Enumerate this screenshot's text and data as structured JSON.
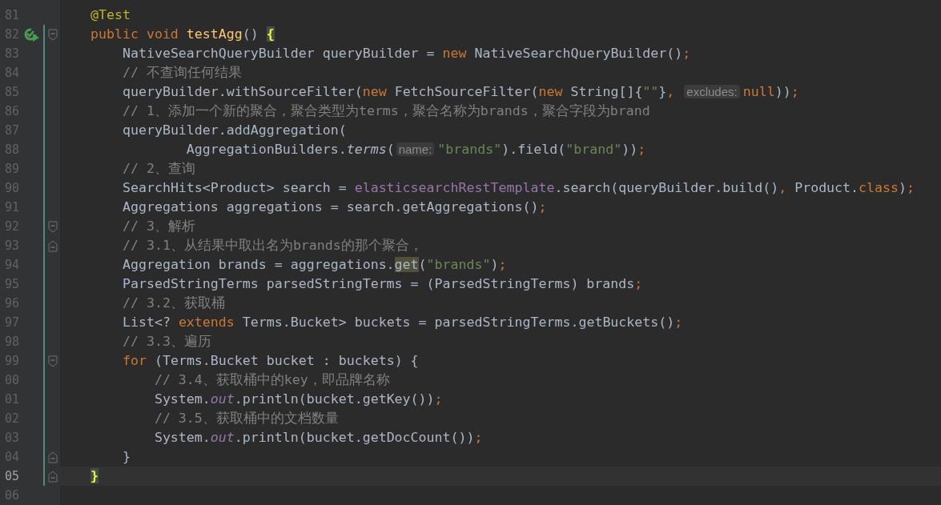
{
  "editor": {
    "lines": [
      {
        "number": "81",
        "modified": false,
        "current": false,
        "run_button": false,
        "fold_start": false,
        "fold_end": false,
        "tokens": [
          {
            "text": "    @Test",
            "kind": "annotation"
          }
        ]
      },
      {
        "number": "82",
        "modified": true,
        "current": false,
        "run_button": true,
        "fold_start": true,
        "fold_end": false,
        "tokens": [
          {
            "text": "    public void ",
            "kind": "keyword"
          },
          {
            "text": "testAgg",
            "kind": "method_decl"
          },
          {
            "text": "() ",
            "kind": "plain"
          },
          {
            "text": "{",
            "kind": "brace_match"
          }
        ]
      },
      {
        "number": "83",
        "modified": true,
        "current": false,
        "run_button": false,
        "fold_start": false,
        "fold_end": false,
        "tokens": [
          {
            "text": "        NativeSearchQueryBuilder queryBuilder = ",
            "kind": "plain"
          },
          {
            "text": "new",
            "kind": "keyword"
          },
          {
            "text": " NativeSearchQueryBuilder()",
            "kind": "plain"
          },
          {
            "text": ";",
            "kind": "punct"
          }
        ]
      },
      {
        "number": "84",
        "modified": true,
        "current": false,
        "run_button": false,
        "fold_start": false,
        "fold_end": false,
        "tokens": [
          {
            "text": "        // 不查询任何结果",
            "kind": "comment"
          }
        ]
      },
      {
        "number": "85",
        "modified": true,
        "current": false,
        "run_button": false,
        "fold_start": false,
        "fold_end": false,
        "tokens": [
          {
            "text": "        queryBuilder.withSourceFilter(",
            "kind": "plain"
          },
          {
            "text": "new",
            "kind": "keyword"
          },
          {
            "text": " FetchSourceFilter(",
            "kind": "plain"
          },
          {
            "text": "new",
            "kind": "keyword"
          },
          {
            "text": " String[]{",
            "kind": "plain"
          },
          {
            "text": "\"\"",
            "kind": "string"
          },
          {
            "text": "}",
            "kind": "plain"
          },
          {
            "text": ", ",
            "kind": "punct"
          },
          {
            "text": "excludes:",
            "kind": "hint"
          },
          {
            "text": "null",
            "kind": "keyword"
          },
          {
            "text": "))",
            "kind": "plain"
          },
          {
            "text": ";",
            "kind": "punct"
          }
        ]
      },
      {
        "number": "86",
        "modified": true,
        "current": false,
        "run_button": false,
        "fold_start": false,
        "fold_end": false,
        "tokens": [
          {
            "text": "        // 1、添加一个新的聚合，聚合类型为terms，聚合名称为brands，聚合字段为brand",
            "kind": "comment"
          }
        ]
      },
      {
        "number": "87",
        "modified": true,
        "current": false,
        "run_button": false,
        "fold_start": false,
        "fold_end": false,
        "tokens": [
          {
            "text": "        queryBuilder.addAggregation(",
            "kind": "plain"
          }
        ]
      },
      {
        "number": "88",
        "modified": true,
        "current": false,
        "run_button": false,
        "fold_start": false,
        "fold_end": false,
        "tokens": [
          {
            "text": "                AggregationBuilders.",
            "kind": "plain"
          },
          {
            "text": "terms",
            "kind": "static_call"
          },
          {
            "text": "(",
            "kind": "plain"
          },
          {
            "text": "name:",
            "kind": "hint"
          },
          {
            "text": "\"brands\"",
            "kind": "string"
          },
          {
            "text": ").field(",
            "kind": "plain"
          },
          {
            "text": "\"brand\"",
            "kind": "string"
          },
          {
            "text": "))",
            "kind": "plain"
          },
          {
            "text": ";",
            "kind": "punct"
          }
        ]
      },
      {
        "number": "89",
        "modified": true,
        "current": false,
        "run_button": false,
        "fold_start": false,
        "fold_end": false,
        "tokens": [
          {
            "text": "        // 2、查询",
            "kind": "comment"
          }
        ]
      },
      {
        "number": "90",
        "modified": true,
        "current": false,
        "run_button": false,
        "fold_start": false,
        "fold_end": false,
        "tokens": [
          {
            "text": "        SearchHits<Product> search = ",
            "kind": "plain"
          },
          {
            "text": "elasticsearchRestTemplate",
            "kind": "field"
          },
          {
            "text": ".search(queryBuilder.build()",
            "kind": "plain"
          },
          {
            "text": ",",
            "kind": "punct"
          },
          {
            "text": " Product.",
            "kind": "plain"
          },
          {
            "text": "class",
            "kind": "keyword"
          },
          {
            "text": ")",
            "kind": "plain"
          },
          {
            "text": ";",
            "kind": "punct"
          }
        ]
      },
      {
        "number": "91",
        "modified": true,
        "current": false,
        "run_button": false,
        "fold_start": false,
        "fold_end": false,
        "tokens": [
          {
            "text": "        Aggregations aggregations = search.getAggregations()",
            "kind": "plain"
          },
          {
            "text": ";",
            "kind": "punct"
          }
        ]
      },
      {
        "number": "92",
        "modified": true,
        "current": false,
        "run_button": false,
        "fold_start": true,
        "fold_end": false,
        "tokens": [
          {
            "text": "        // 3、解析",
            "kind": "comment"
          }
        ]
      },
      {
        "number": "93",
        "modified": true,
        "current": false,
        "run_button": false,
        "fold_start": false,
        "fold_end": true,
        "tokens": [
          {
            "text": "        // 3.1、从结果中取出名为brands的那个聚合，",
            "kind": "comment"
          }
        ]
      },
      {
        "number": "94",
        "modified": true,
        "current": false,
        "run_button": false,
        "fold_start": false,
        "fold_end": false,
        "tokens": [
          {
            "text": "        Aggregation brands = aggregations.",
            "kind": "plain"
          },
          {
            "text": "get",
            "kind": "usage"
          },
          {
            "text": "(",
            "kind": "plain"
          },
          {
            "text": "\"brands\"",
            "kind": "string"
          },
          {
            "text": ")",
            "kind": "plain"
          },
          {
            "text": ";",
            "kind": "punct"
          }
        ]
      },
      {
        "number": "95",
        "modified": true,
        "current": false,
        "run_button": false,
        "fold_start": false,
        "fold_end": false,
        "tokens": [
          {
            "text": "        ParsedStringTerms parsedStringTerms = (ParsedStringTerms) brands",
            "kind": "plain"
          },
          {
            "text": ";",
            "kind": "punct"
          }
        ]
      },
      {
        "number": "96",
        "modified": true,
        "current": false,
        "run_button": false,
        "fold_start": false,
        "fold_end": false,
        "tokens": [
          {
            "text": "        // 3.2、获取桶",
            "kind": "comment"
          }
        ]
      },
      {
        "number": "97",
        "modified": true,
        "current": false,
        "run_button": false,
        "fold_start": false,
        "fold_end": false,
        "tokens": [
          {
            "text": "        List<? ",
            "kind": "plain"
          },
          {
            "text": "extends",
            "kind": "keyword"
          },
          {
            "text": " Terms.Bucket> buckets = parsedStringTerms.getBuckets()",
            "kind": "plain"
          },
          {
            "text": ";",
            "kind": "punct"
          }
        ]
      },
      {
        "number": "98",
        "modified": true,
        "current": false,
        "run_button": false,
        "fold_start": false,
        "fold_end": false,
        "tokens": [
          {
            "text": "        // 3.3、遍历",
            "kind": "comment"
          }
        ]
      },
      {
        "number": "99",
        "modified": true,
        "current": false,
        "run_button": false,
        "fold_start": true,
        "fold_end": false,
        "tokens": [
          {
            "text": "        for",
            "kind": "keyword"
          },
          {
            "text": " (Terms.Bucket bucket : buckets) {",
            "kind": "plain"
          }
        ]
      },
      {
        "number": "00",
        "modified": true,
        "current": false,
        "run_button": false,
        "fold_start": false,
        "fold_end": false,
        "tokens": [
          {
            "text": "            // 3.4、获取桶中的key，即品牌名称",
            "kind": "comment"
          }
        ]
      },
      {
        "number": "01",
        "modified": true,
        "current": false,
        "run_button": false,
        "fold_start": false,
        "fold_end": false,
        "tokens": [
          {
            "text": "            System.",
            "kind": "plain"
          },
          {
            "text": "out",
            "kind": "static_field"
          },
          {
            "text": ".println(bucket.getKey())",
            "kind": "plain"
          },
          {
            "text": ";",
            "kind": "punct"
          }
        ]
      },
      {
        "number": "02",
        "modified": true,
        "current": false,
        "run_button": false,
        "fold_start": false,
        "fold_end": false,
        "tokens": [
          {
            "text": "            // 3.5、获取桶中的文档数量",
            "kind": "comment"
          }
        ]
      },
      {
        "number": "03",
        "modified": true,
        "current": false,
        "run_button": false,
        "fold_start": false,
        "fold_end": false,
        "tokens": [
          {
            "text": "            System.",
            "kind": "plain"
          },
          {
            "text": "out",
            "kind": "static_field"
          },
          {
            "text": ".println(bucket.getDocCount())",
            "kind": "plain"
          },
          {
            "text": ";",
            "kind": "punct"
          }
        ]
      },
      {
        "number": "04",
        "modified": true,
        "current": false,
        "run_button": false,
        "fold_start": false,
        "fold_end": true,
        "tokens": [
          {
            "text": "        }",
            "kind": "plain"
          }
        ]
      },
      {
        "number": "05",
        "modified": true,
        "current": true,
        "run_button": false,
        "fold_start": false,
        "fold_end": true,
        "tokens": [
          {
            "text": "    }",
            "kind": "brace_match"
          }
        ]
      },
      {
        "number": "06",
        "modified": false,
        "current": false,
        "run_button": false,
        "fold_start": false,
        "fold_end": false
      }
    ]
  }
}
